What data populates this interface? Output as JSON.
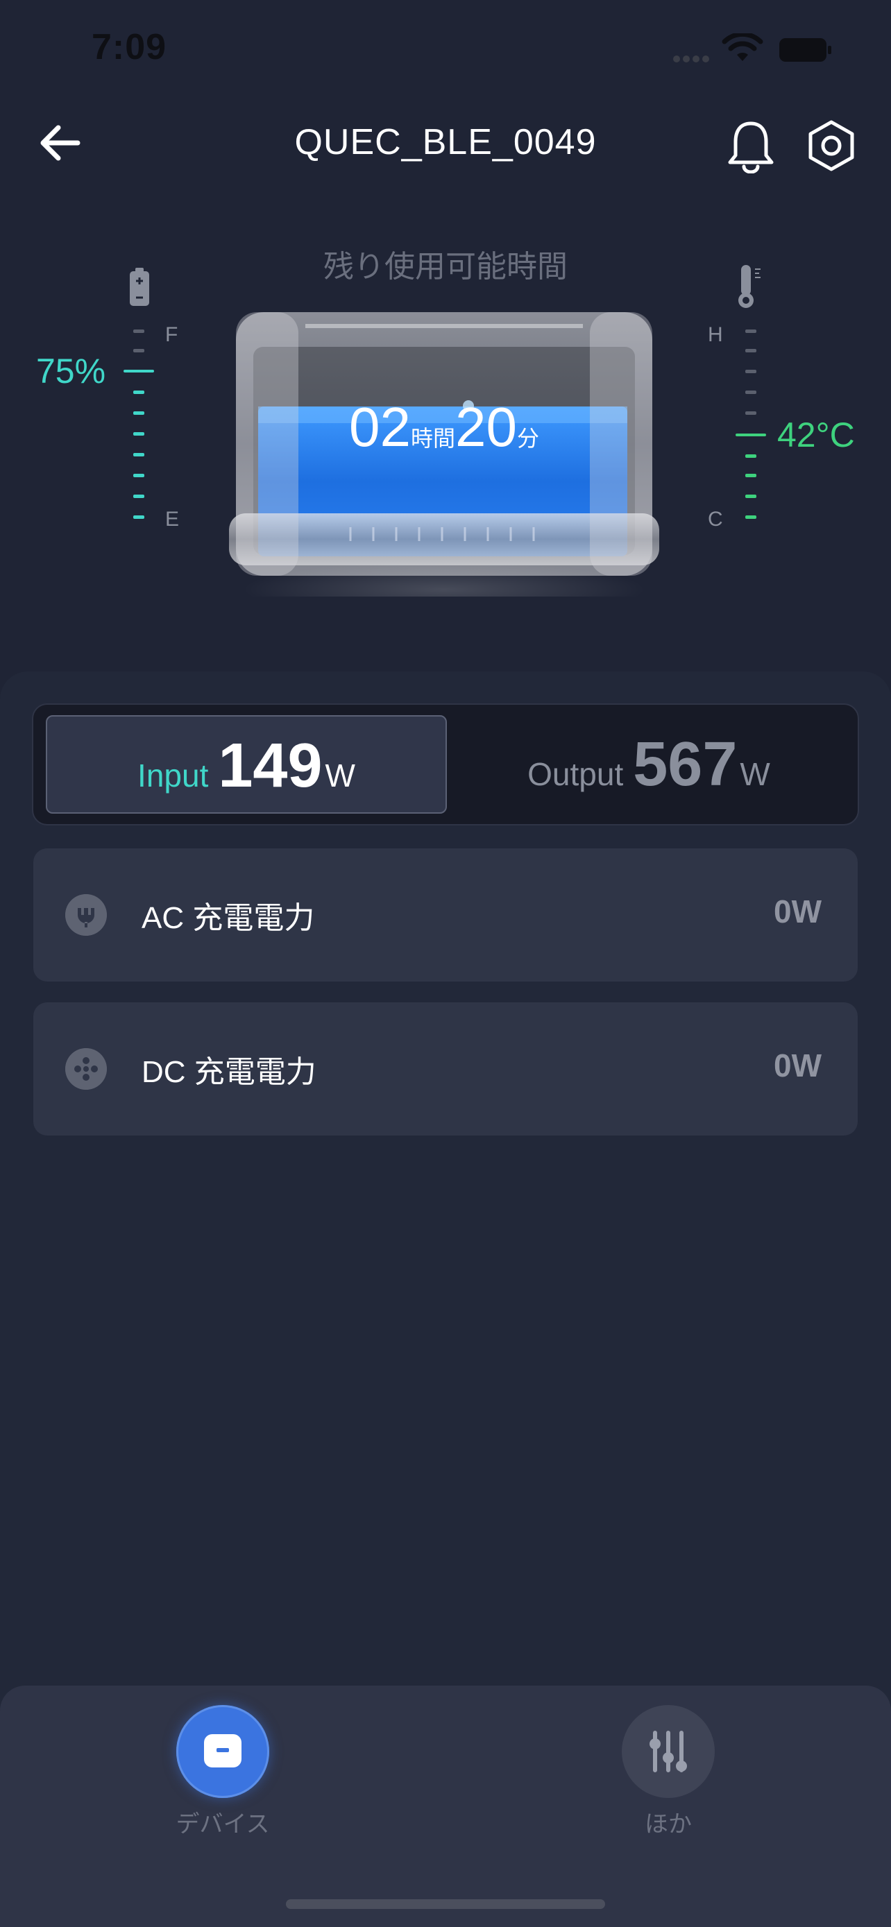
{
  "status_bar": {
    "time": "7:09"
  },
  "header": {
    "title": "QUEC_BLE_0049"
  },
  "hero": {
    "remaining_label": "残り使用可能時間",
    "battery_percent": "75%",
    "battery_level": 0.75,
    "temperature": "42°C",
    "fuel_full": "F",
    "fuel_empty": "E",
    "temp_high": "H",
    "temp_cold": "C",
    "hours": "02",
    "hours_unit": "時間",
    "minutes": "20",
    "minutes_unit": "分"
  },
  "io": {
    "input_label": "Input",
    "input_value": "149",
    "input_unit": "W",
    "output_label": "Output",
    "output_value": "567",
    "output_unit": "W"
  },
  "rows": [
    {
      "label": "AC 充電電力",
      "value": "0W",
      "icon": "ac-plug-icon"
    },
    {
      "label": "DC 充電電力",
      "value": "0W",
      "icon": "dc-plug-icon"
    }
  ],
  "tabs": [
    {
      "label": "デバイス",
      "icon": "device-icon",
      "active": true
    },
    {
      "label": "ほか",
      "icon": "sliders-icon",
      "active": false
    }
  ],
  "colors": {
    "background": "#1f2435",
    "battery_accent": "#40d7c9",
    "temp_accent": "#3ed27e",
    "active_tab": "#3b74e0",
    "fluid_blue": "#2a7ff0"
  }
}
